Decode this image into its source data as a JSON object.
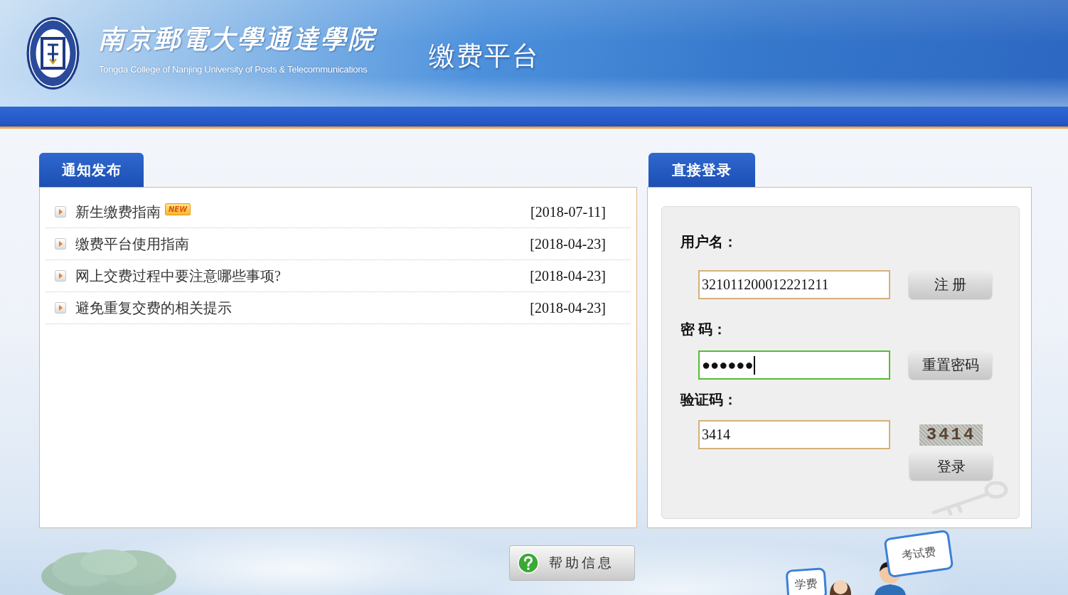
{
  "header": {
    "school_name": "南京郵電大學通達學院",
    "school_name_en": "Tongda College of Nanjing University of Posts & Telecommunications",
    "title": "缴费平台"
  },
  "notices": {
    "tab": "通知发布",
    "items": [
      {
        "title": "新生缴费指南",
        "badge": "NEW",
        "date": "[2018-07-11]"
      },
      {
        "title": "缴费平台使用指南",
        "date": "[2018-04-23]"
      },
      {
        "title": "网上交费过程中要注意哪些事项?",
        "date": "[2018-04-23]"
      },
      {
        "title": "避免重复交费的相关提示",
        "date": "[2018-04-23]"
      }
    ]
  },
  "login": {
    "tab": "直接登录",
    "fields": [
      {
        "kind": "text",
        "label": "用户名：",
        "value": "321011200012221211",
        "focused": false,
        "button": "注 册"
      },
      {
        "kind": "password",
        "label": "密 码：",
        "value": "●●●●●●",
        "focused": true,
        "button": "重置密码"
      },
      {
        "kind": "captcha",
        "label": "验证码：",
        "value": "3414",
        "focused": false,
        "captcha": "3414"
      }
    ],
    "submit": "登录"
  },
  "help_button": "帮助信息",
  "illustration": {
    "bubbles": [
      "学费",
      "考试费"
    ]
  }
}
